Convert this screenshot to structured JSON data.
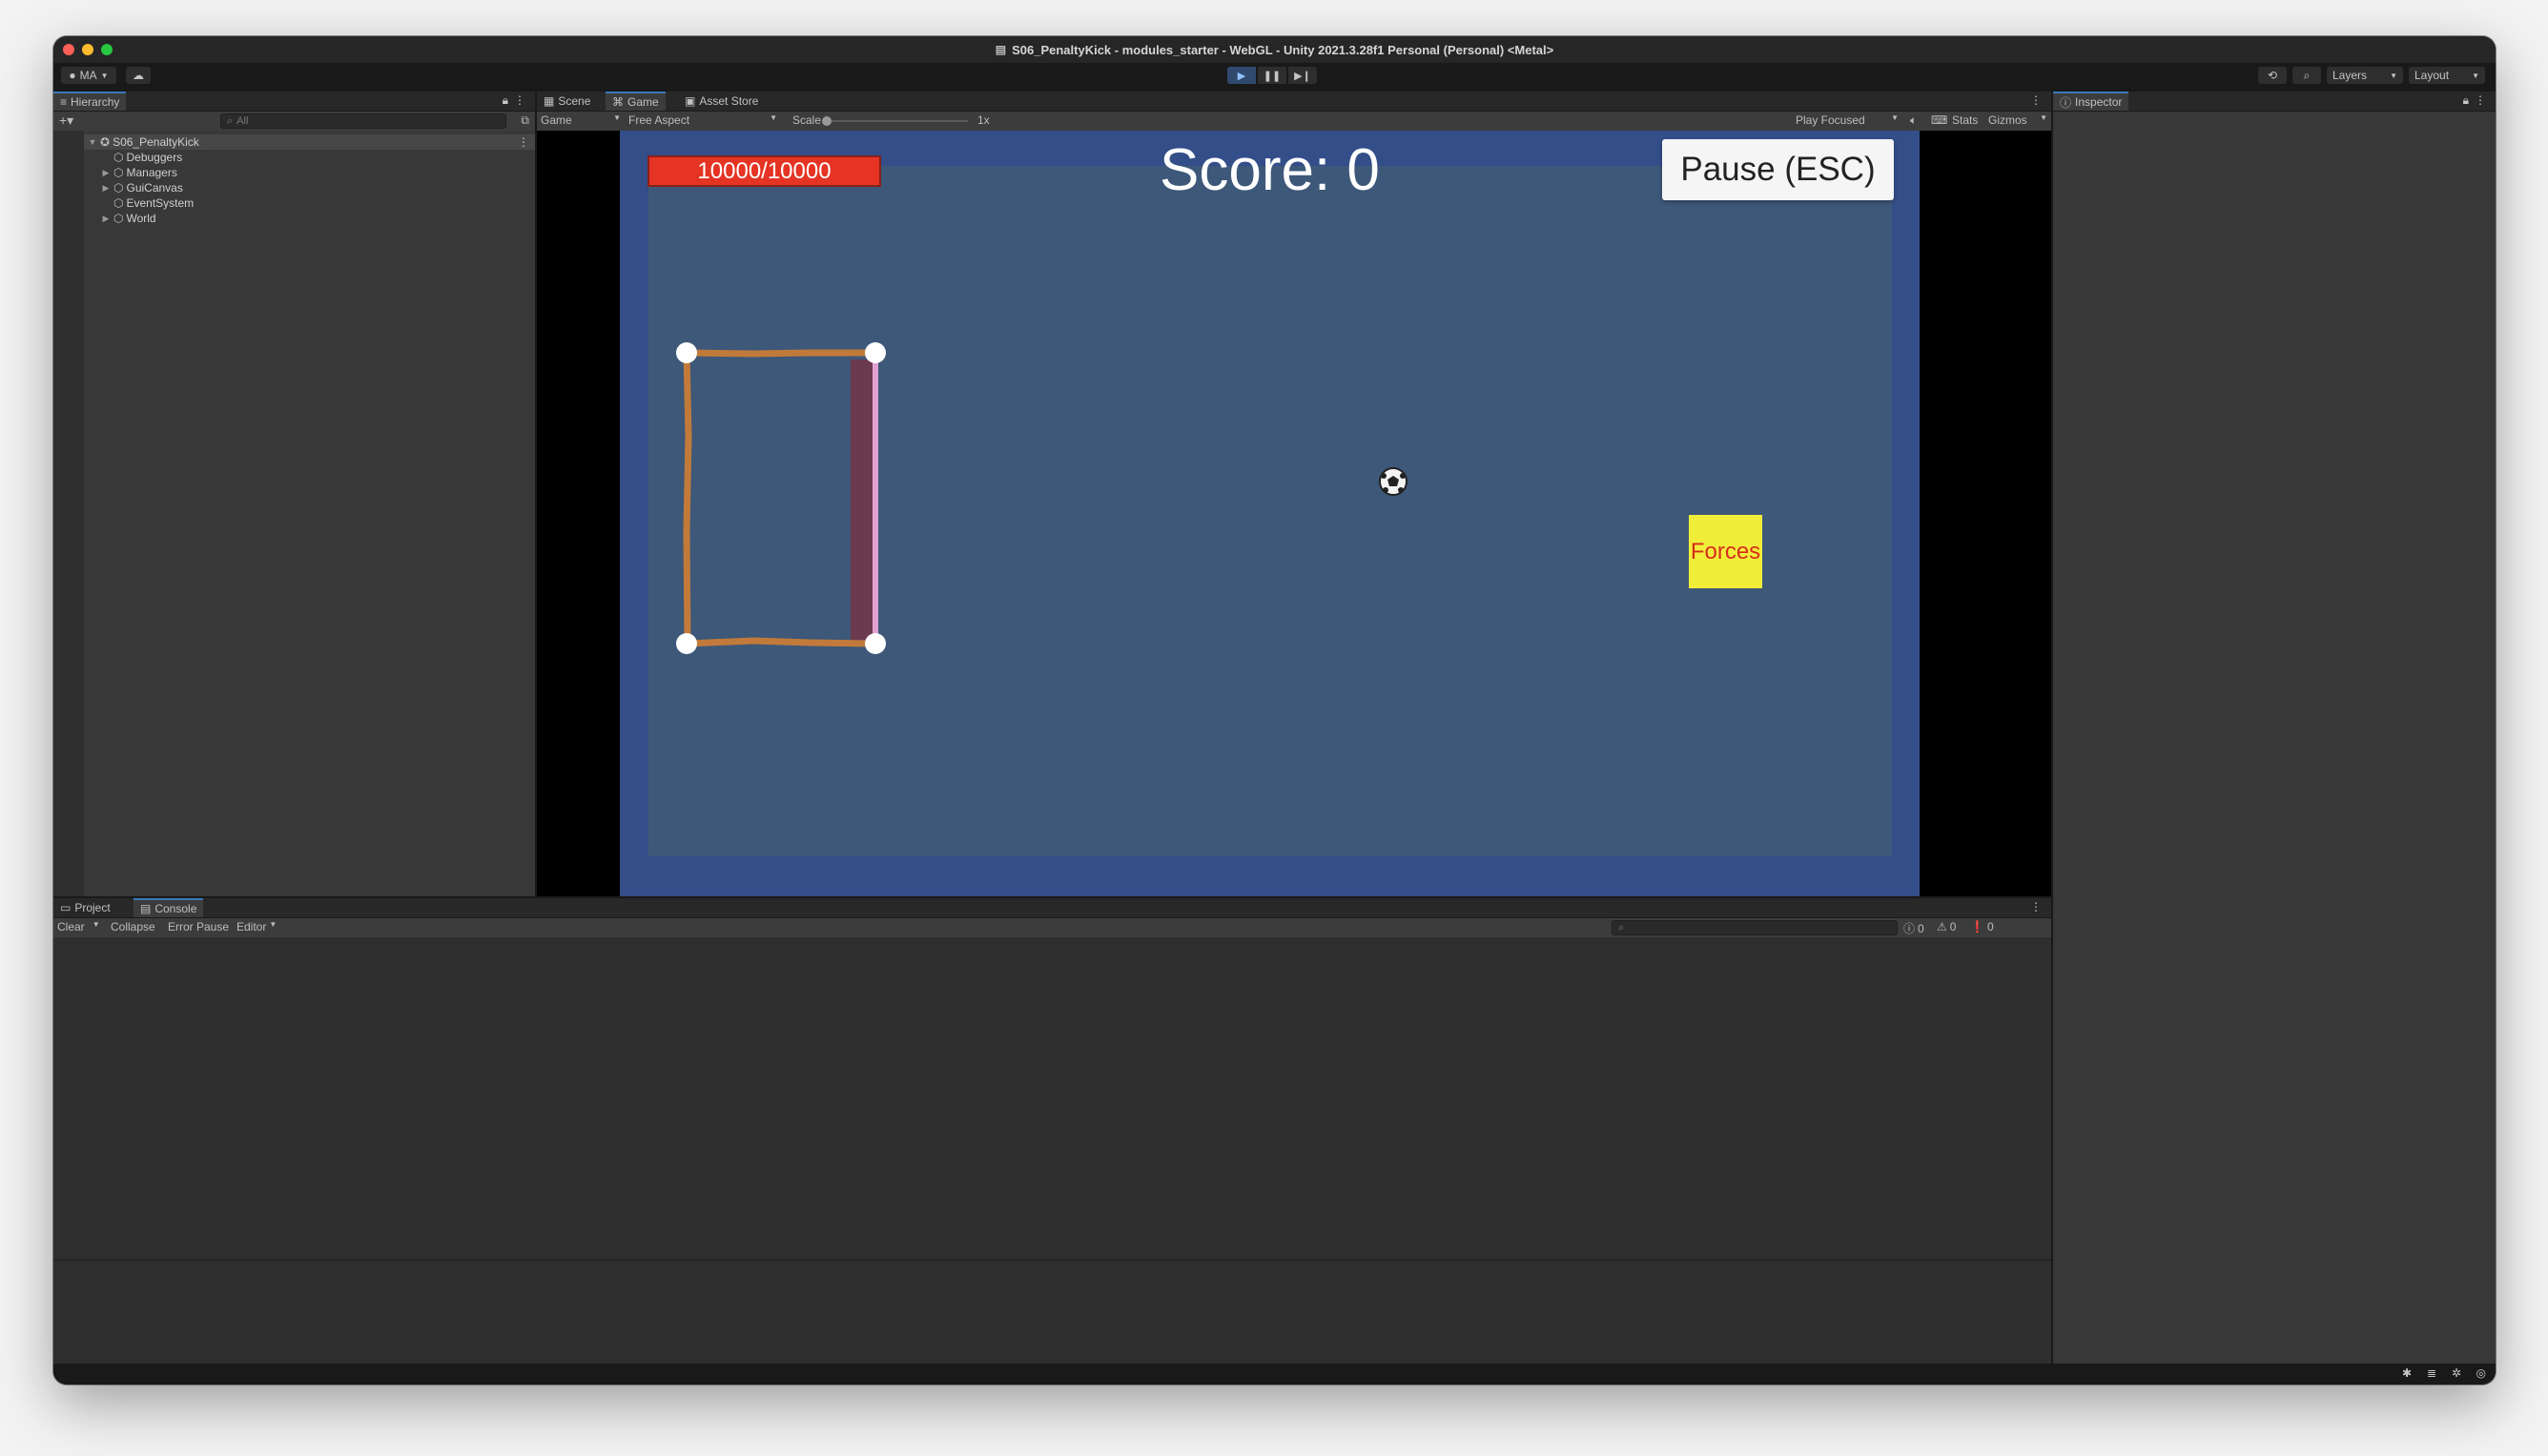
{
  "window": {
    "title": "S06_PenaltyKick - modules_starter - WebGL - Unity 2021.3.28f1 Personal (Personal) <Metal>"
  },
  "toolbar": {
    "account_label": "MA",
    "layers_label": "Layers",
    "layout_label": "Layout"
  },
  "hierarchy": {
    "tab_label": "Hierarchy",
    "search_placeholder": "All",
    "root": "S06_PenaltyKick",
    "items": [
      "Debuggers",
      "Managers",
      "GuiCanvas",
      "EventSystem",
      "World"
    ]
  },
  "game_view": {
    "tabs": [
      "Scene",
      "Game",
      "Asset Store"
    ],
    "display_select": "Game",
    "aspect_select": "Free Aspect",
    "scale_label": "Scale",
    "scale_value": "1x",
    "play_mode_select": "Play Focused",
    "stats_label": "Stats",
    "gizmos_label": "Gizmos"
  },
  "game": {
    "health_text": "10000/10000",
    "health_fraction": 1.0,
    "score_text": "Score: 0",
    "pause_label": "Pause (ESC)",
    "forces_label": "Forces"
  },
  "inspector": {
    "tab_label": "Inspector"
  },
  "console": {
    "tabs": [
      "Project",
      "Console"
    ],
    "clear_label": "Clear",
    "collapse_label": "Collapse",
    "error_pause_label": "Error Pause",
    "editor_label": "Editor",
    "log_count": "0",
    "warning_count": "0",
    "error_count": "0"
  },
  "colors": {
    "accent": "#3a79bb",
    "health_bar": "#e53424",
    "forces_button": "#f1ee3a",
    "goal_frame": "#c27a3a"
  }
}
